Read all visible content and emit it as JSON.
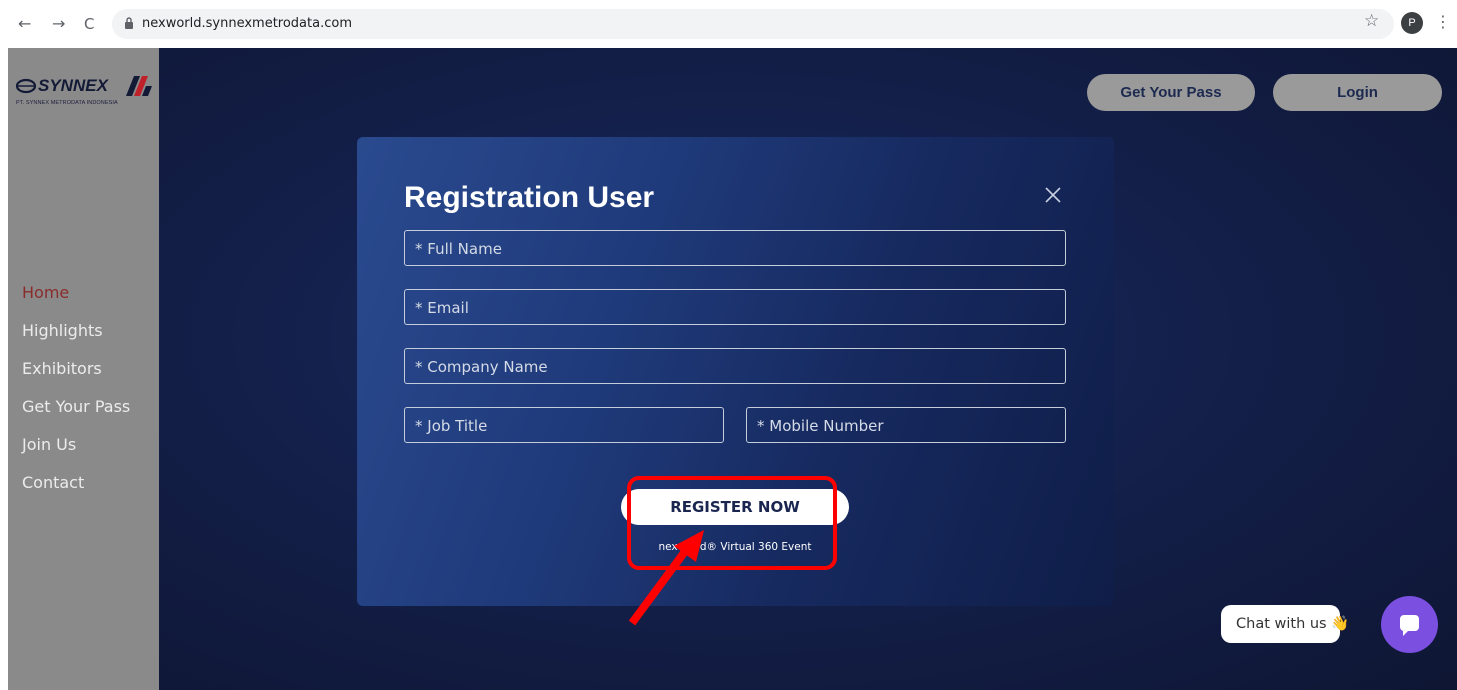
{
  "browser": {
    "back_icon": "←",
    "forward_icon": "→",
    "reload_icon": "C",
    "url": "nexworld.synnexmetrodata.com",
    "bookmark_icon": "☆",
    "profile_initial": "P",
    "menu_icon": "⋮"
  },
  "logo": {
    "brand": "SYNNEX",
    "subtitle": "PT. SYNNEX METRODATA INDONESIA"
  },
  "sidebar": {
    "items": [
      {
        "label": "Home",
        "active": true
      },
      {
        "label": "Highlights"
      },
      {
        "label": "Exhibitors"
      },
      {
        "label": "Get Your Pass"
      },
      {
        "label": "Join Us"
      },
      {
        "label": "Contact"
      }
    ]
  },
  "header": {
    "get_pass_label": "Get Your Pass",
    "login_label": "Login"
  },
  "modal": {
    "title": "Registration User",
    "fields": {
      "full_name": "* Full Name",
      "email": "* Email",
      "company": "* Company Name",
      "job_title": "* Job Title",
      "mobile": "* Mobile Number"
    },
    "register_label": "REGISTER NOW",
    "footer": "nexworld® Virtual 360 Event"
  },
  "chat": {
    "label": "Chat with us 👋"
  },
  "colors": {
    "page_bg": "#121b3d",
    "sidebar_bg": "#8a8a8a",
    "active_menu": "#8b2c2c",
    "annotation": "#ff0000",
    "chat_button": "#7b4fe0"
  }
}
